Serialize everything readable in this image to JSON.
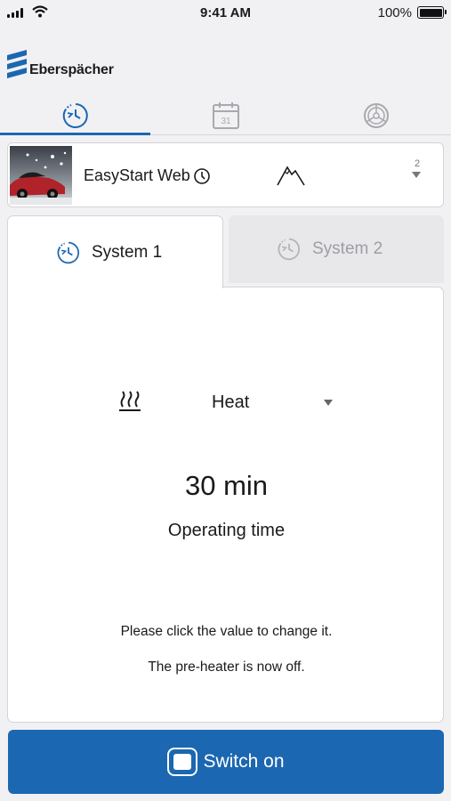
{
  "status_bar": {
    "time": "9:41 AM",
    "battery": "100%"
  },
  "brand": {
    "name": "Eberspächer"
  },
  "top_tabs": [
    {
      "icon": "timer-icon",
      "active": true
    },
    {
      "icon": "calendar-icon",
      "label": "31",
      "active": false
    },
    {
      "icon": "steering-wheel-icon",
      "active": false
    }
  ],
  "device": {
    "name": "EasyStart Web",
    "icon": "clock-icon",
    "mode_icon": "mountain-icon",
    "number": "2"
  },
  "system_tabs": [
    {
      "label": "System 1",
      "active": true
    },
    {
      "label": "System 2",
      "active": false
    }
  ],
  "mode": {
    "icon": "heat-icon",
    "value": "Heat"
  },
  "operating": {
    "value": "30 min",
    "label": "Operating time"
  },
  "messages": {
    "hint": "Please click the value to change it.",
    "state": "The pre-heater is now off."
  },
  "switch_button": {
    "label": "Switch on",
    "color": "#1b67b1"
  }
}
